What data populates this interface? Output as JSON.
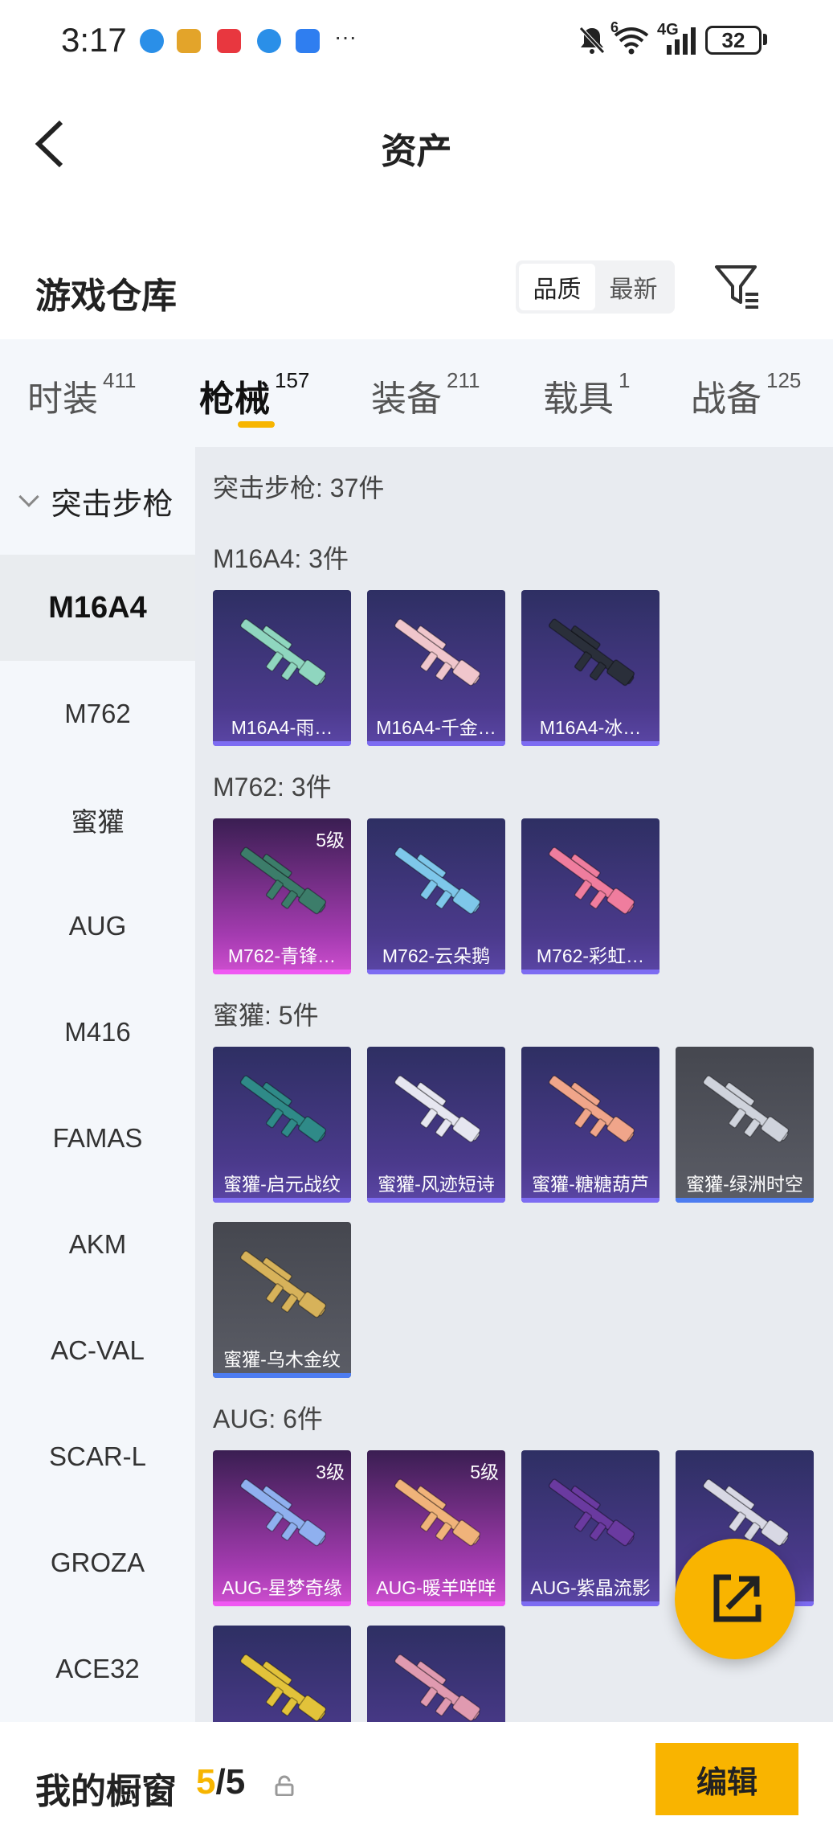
{
  "status_bar": {
    "time": "3:17",
    "network_label": "4G",
    "wifi_label": "6",
    "battery": "32",
    "overflow": "···"
  },
  "navbar": {
    "title": "资产"
  },
  "warehouse": {
    "title": "游戏仓库",
    "sort_options": [
      "品质",
      "最新"
    ]
  },
  "tabs": [
    {
      "label": "时装",
      "count": "411"
    },
    {
      "label": "枪械",
      "count": "157"
    },
    {
      "label": "装备",
      "count": "211"
    },
    {
      "label": "载具",
      "count": "1"
    },
    {
      "label": "战备",
      "count": "125"
    }
  ],
  "sidebar": {
    "category": "突击步枪",
    "items": [
      "M16A4",
      "M762",
      "蜜獾",
      "AUG",
      "M416",
      "FAMAS",
      "AKM",
      "AC-VAL",
      "SCAR-L",
      "GROZA",
      "ACE32"
    ]
  },
  "content": {
    "summary": "突击步枪: 37件",
    "sections": [
      {
        "title": "M16A4: 3件",
        "items": [
          {
            "name": "M16A4-雨…",
            "rarity": "blue",
            "level": "",
            "gun_color": "#8fd6bf"
          },
          {
            "name": "M16A4-千金…",
            "rarity": "blue",
            "level": "",
            "gun_color": "#f0c6cc"
          },
          {
            "name": "M16A4-冰…",
            "rarity": "blue",
            "level": "",
            "gun_color": "#2a2f3a"
          }
        ]
      },
      {
        "title": "M762: 3件",
        "items": [
          {
            "name": "M762-青锋…",
            "rarity": "pink",
            "level": "5级",
            "gun_color": "#3c7d6a"
          },
          {
            "name": "M762-云朵鹅",
            "rarity": "blue",
            "level": "",
            "gun_color": "#7ec7ea"
          },
          {
            "name": "M762-彩虹…",
            "rarity": "blue",
            "level": "",
            "gun_color": "#ef7d9e"
          }
        ]
      },
      {
        "title": "蜜獾: 5件",
        "items": [
          {
            "name": "蜜獾-启元战纹",
            "rarity": "blue",
            "level": "",
            "gun_color": "#2f8a88"
          },
          {
            "name": "蜜獾-风迹短诗",
            "rarity": "blue",
            "level": "",
            "gun_color": "#e6e6f0"
          },
          {
            "name": "蜜獾-糖糖葫芦",
            "rarity": "blue",
            "level": "",
            "gun_color": "#f0a58a"
          },
          {
            "name": "蜜獾-绿洲时空",
            "rarity": "grey",
            "level": "",
            "gun_color": "#cfd3dc"
          },
          {
            "name": "蜜獾-乌木金纹",
            "rarity": "grey",
            "level": "",
            "gun_color": "#d7b25a"
          }
        ]
      },
      {
        "title": "AUG: 6件",
        "items": [
          {
            "name": "AUG-星梦奇缘",
            "rarity": "pink",
            "level": "3级",
            "gun_color": "#8fb0ef"
          },
          {
            "name": "AUG-暖羊咩咩",
            "rarity": "pink",
            "level": "5级",
            "gun_color": "#f0b37a"
          },
          {
            "name": "AUG-紫晶流影",
            "rarity": "blue",
            "level": "",
            "gun_color": "#6a3aa0"
          },
          {
            "name": "AUG-…装",
            "rarity": "blue",
            "level": "",
            "gun_color": "#d8d8e4"
          },
          {
            "name": "",
            "rarity": "blue",
            "level": "",
            "gun_color": "#e2c23a"
          },
          {
            "name": "",
            "rarity": "blue",
            "level": "",
            "gun_color": "#e09ab0"
          }
        ]
      }
    ]
  },
  "bottom": {
    "label": "我的橱窗",
    "count_current": "5",
    "count_total": "/5",
    "edit_label": "编辑"
  }
}
